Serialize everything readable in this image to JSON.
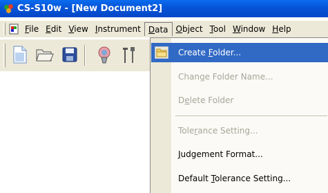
{
  "window": {
    "title": "CS-S10w - [New Document2]"
  },
  "menubar": {
    "items": [
      {
        "prefix": "",
        "mnemonic": "F",
        "suffix": "ile"
      },
      {
        "prefix": "",
        "mnemonic": "E",
        "suffix": "dit"
      },
      {
        "prefix": "",
        "mnemonic": "V",
        "suffix": "iew"
      },
      {
        "prefix": "",
        "mnemonic": "I",
        "suffix": "nstrument"
      },
      {
        "prefix": "",
        "mnemonic": "D",
        "suffix": "ata"
      },
      {
        "prefix": "",
        "mnemonic": "O",
        "suffix": "bject"
      },
      {
        "prefix": "",
        "mnemonic": "T",
        "suffix": "ool"
      },
      {
        "prefix": "",
        "mnemonic": "W",
        "suffix": "indow"
      },
      {
        "prefix": "",
        "mnemonic": "H",
        "suffix": "elp"
      }
    ],
    "open_menu": "Data"
  },
  "toolbar": {
    "buttons": [
      "new-document-icon",
      "open-folder-icon",
      "save-disk-icon",
      "instrument-icon",
      "tools-icon"
    ]
  },
  "data_menu": {
    "items": [
      {
        "prefix": "Create ",
        "mnemonic": "F",
        "suffix": "older...",
        "state": "selected",
        "icon": "folder-icon"
      },
      {
        "prefix": "Chan",
        "mnemonic": "g",
        "suffix": "e Folder Name...",
        "state": "disabled"
      },
      {
        "prefix": "D",
        "mnemonic": "e",
        "suffix": "lete Folder",
        "state": "disabled"
      },
      {
        "prefix": "Tole",
        "mnemonic": "r",
        "suffix": "ance Setting...",
        "state": "disabled"
      },
      {
        "prefix": "",
        "mnemonic": "J",
        "suffix": "udgement Format...",
        "state": "enabled"
      },
      {
        "prefix": "Default ",
        "mnemonic": "T",
        "suffix": "olerance Setting...",
        "state": "enabled"
      }
    ]
  },
  "colors": {
    "title_bar": "#0654d6",
    "menu_highlight": "#316ac5",
    "disabled_text": "#a7a698",
    "chrome": "#ece9d8"
  }
}
